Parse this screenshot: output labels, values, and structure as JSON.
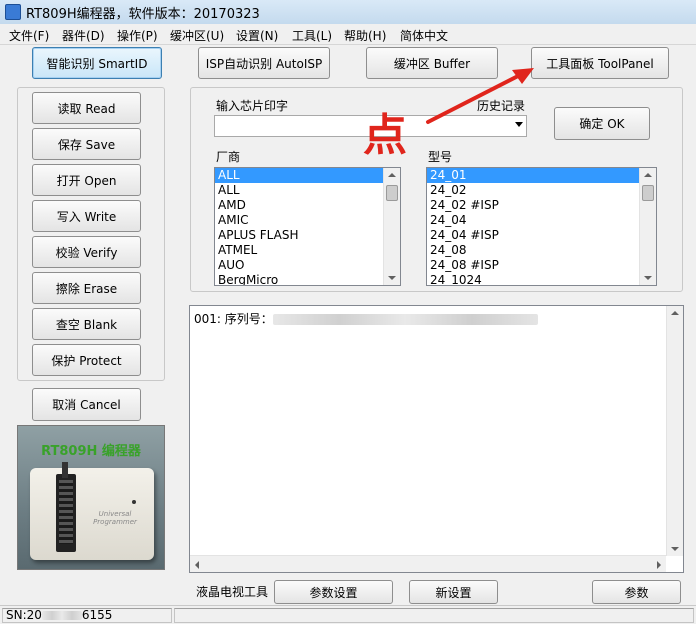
{
  "window": {
    "title": "RT809H编程器，软件版本：20170323"
  },
  "menu": {
    "items": [
      "文件(F)",
      "器件(D)",
      "操作(P)",
      "缓冲区(U)",
      "设置(N)",
      "工具(L)",
      "帮助(H)",
      "简体中文"
    ]
  },
  "toolbar": {
    "smartid": "智能识别 SmartID",
    "autoisp": "ISP自动识别 AutoISP",
    "buffer": "缓冲区 Buffer",
    "toolpanel": "工具面板 ToolPanel"
  },
  "operations": {
    "read": "读取 Read",
    "save": "保存 Save",
    "open": "打开 Open",
    "write": "写入 Write",
    "verify": "校验 Verify",
    "erase": "擦除 Erase",
    "blank": "查空 Blank",
    "protect": "保护 Protect",
    "cancel": "取消 Cancel"
  },
  "chip": {
    "input_label": "输入芯片印字",
    "history_label": "历史记录",
    "ok": "确定 OK",
    "vendor_label": "厂商",
    "model_label": "型号",
    "vendors": [
      "ALL",
      "ALL",
      "AMD",
      "AMIC",
      "APLUS FLASH",
      "ATMEL",
      "AUO",
      "BergMicro"
    ],
    "models": [
      "24_01",
      "24_02",
      "24_02 #ISP",
      "24_04",
      "24_04 #ISP",
      "24_08",
      "24_08 #ISP",
      "24_1024"
    ]
  },
  "output": {
    "line1_prefix": "001: 序列号："
  },
  "bottom": {
    "lcd_tools": "液晶电视工具",
    "param_settings": "参数设置",
    "new_settings": "新设置",
    "params": "参数"
  },
  "status": {
    "sn": "SN:20",
    "sn_tail": "6155"
  },
  "product": {
    "title": "RT809H 编程器",
    "logo": "Universal Programmer"
  },
  "annotation": {
    "text": "点"
  },
  "colors": {
    "annotation": "#e0251c",
    "selection": "#3399ff",
    "product_title": "#39a22a"
  }
}
